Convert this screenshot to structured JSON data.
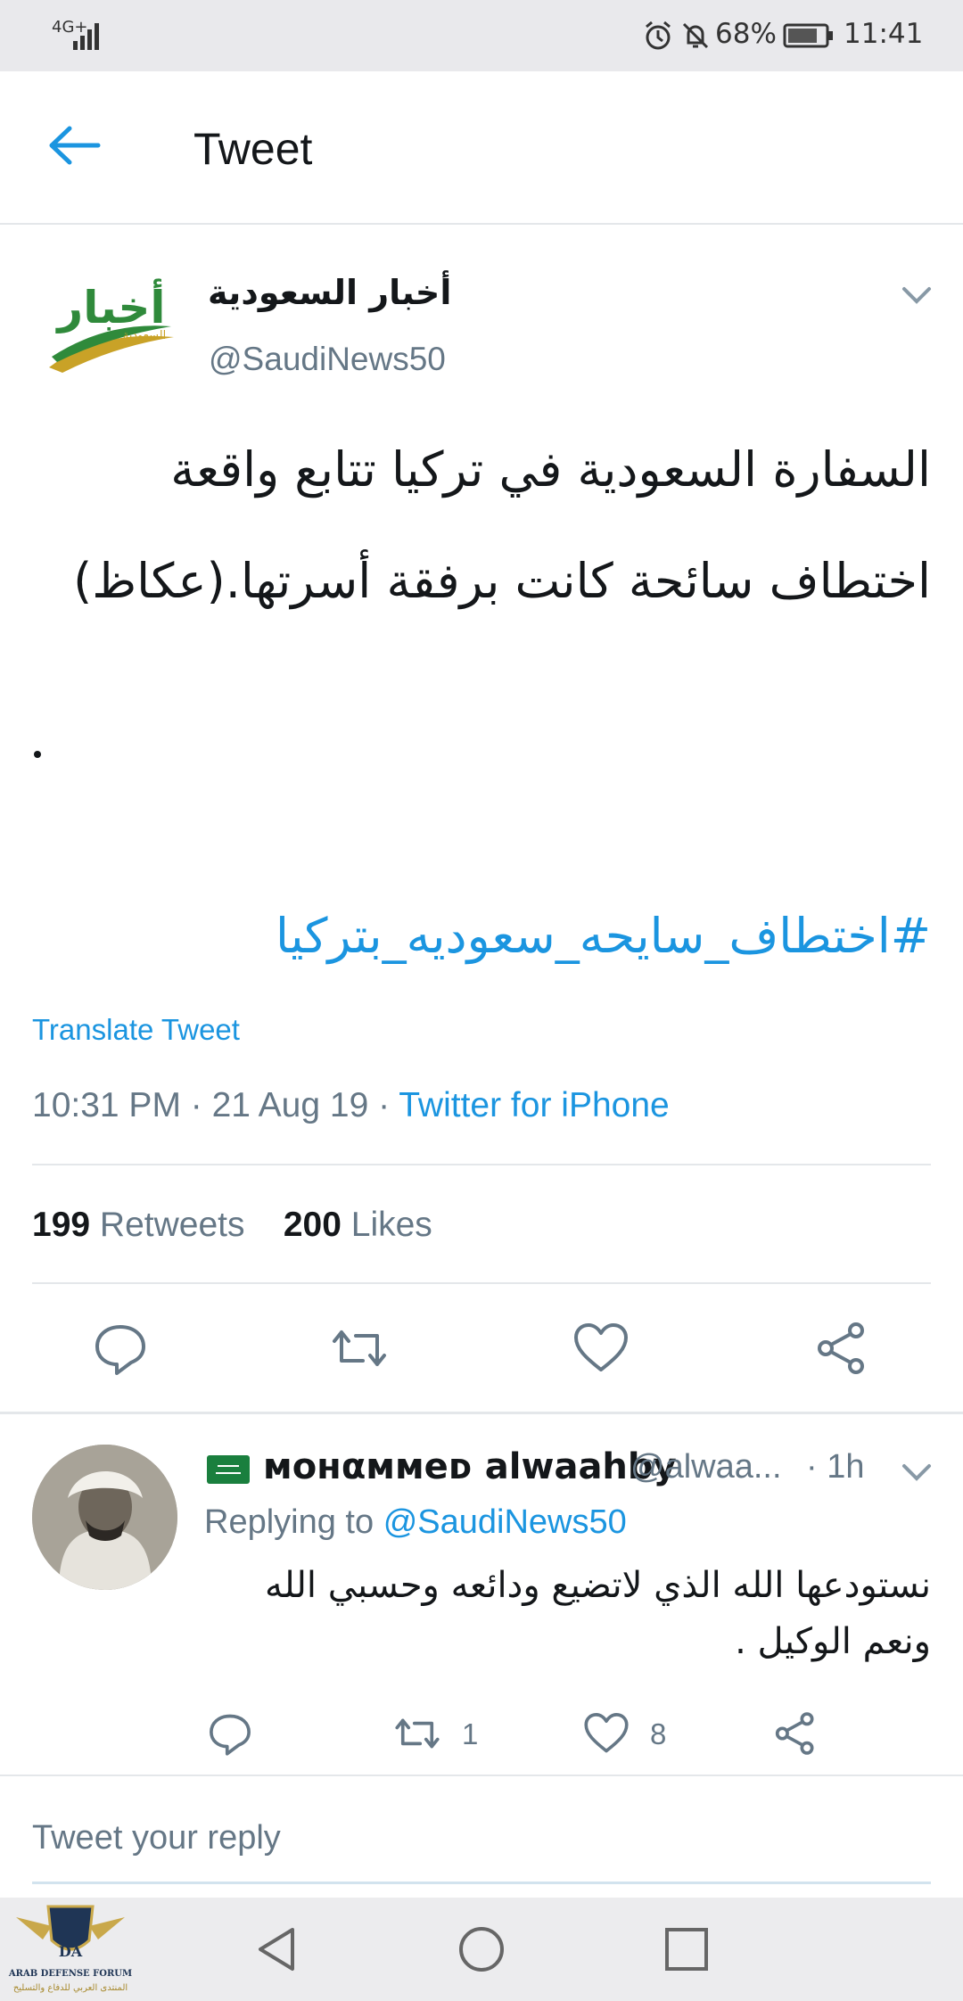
{
  "status_bar": {
    "network": "4G+",
    "battery": "68%",
    "time": "11:41"
  },
  "header": {
    "title": "Tweet"
  },
  "tweet": {
    "author_name": "أخبار السعودية",
    "author_handle": "@SaudiNews50",
    "avatar_text_top": "أخبار",
    "avatar_text_bottom": "السعودية",
    "text_line1": "السفارة السعودية في تركيا تتابع واقعة",
    "text_line2": "اختطاف سائحة كانت برفقة أسرتها.(عكاظ)",
    "hashtag": "#اختطاف_سايحه_سعوديه_بتركيا",
    "translate_label": "Translate Tweet",
    "time": "10:31 PM",
    "date": "21 Aug 19",
    "source": "Twitter for iPhone",
    "retweet_count": "199",
    "retweet_label": "Retweets",
    "like_count": "200",
    "like_label": "Likes"
  },
  "reply": {
    "name": "ᴍoнαммeᴅ alwaahby",
    "handle": "@alwaa...",
    "time": "· 1h",
    "replying_prefix": "Replying to",
    "replying_to": "@SaudiNews50",
    "text_line1": "نستودعها الله الذي لاتضيع ودائعه وحسبي الله",
    "text_line2": "ونعم الوكيل .",
    "retweet_count": "1",
    "like_count": "8"
  },
  "composer": {
    "placeholder": "Tweet your reply"
  },
  "watermark": {
    "line1": "ARAB DEFENSE FORUM",
    "line2": "المنتدى العربي للدفاع والتسليح",
    "badge": "DA"
  },
  "colors": {
    "accent": "#1b95e0",
    "muted": "#657786",
    "text": "#14171a"
  }
}
